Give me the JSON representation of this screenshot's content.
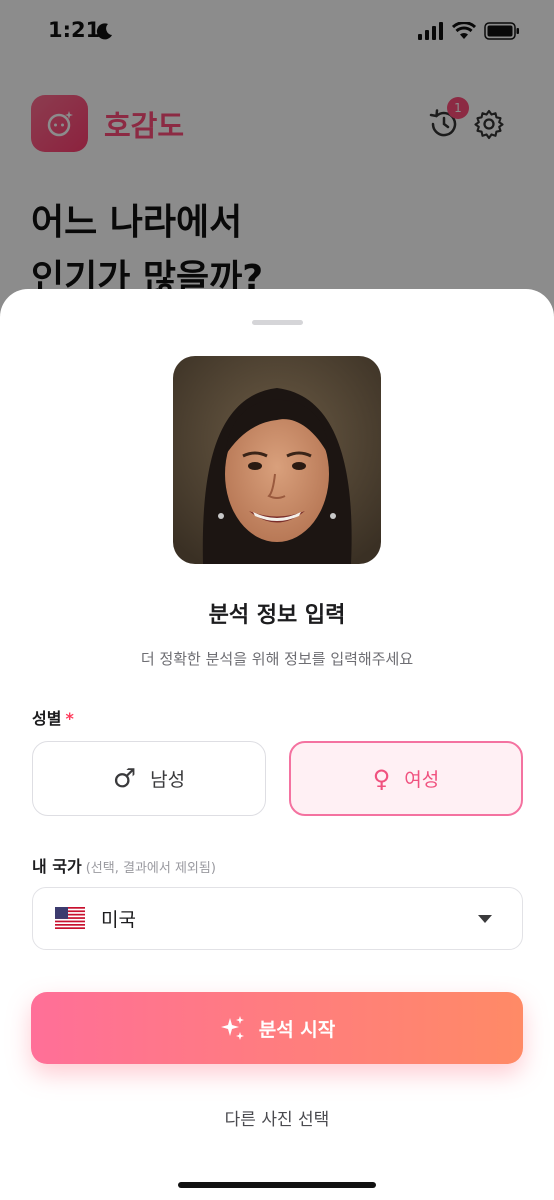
{
  "status_bar": {
    "time": "1:21"
  },
  "app": {
    "name": "호감도",
    "history_badge": "1",
    "headline_line1": "어느 나라에서",
    "headline_line2": "인기가 많을까?"
  },
  "sheet": {
    "title": "분석 정보 입력",
    "subtitle": "더 정확한 분석을 위해 정보를 입력해주세요",
    "gender": {
      "label": "성별",
      "required_mark": "*",
      "options": [
        {
          "label": "남성",
          "symbol": "♂",
          "selected": false
        },
        {
          "label": "여성",
          "symbol": "♀",
          "selected": true
        }
      ]
    },
    "country": {
      "label": "내 국가",
      "hint": "(선택, 결과에서 제외됨)",
      "value": "미국",
      "flag": "us-flag-icon"
    },
    "start_button": "분석 시작",
    "other_photo_link": "다른 사진 선택"
  },
  "colors": {
    "accent": "#ff4d7a",
    "female_selected_border": "#f472a0",
    "female_selected_bg": "#fff0f4",
    "button_gradient_start": "#ff6f98",
    "button_gradient_end": "#ff8a66"
  }
}
